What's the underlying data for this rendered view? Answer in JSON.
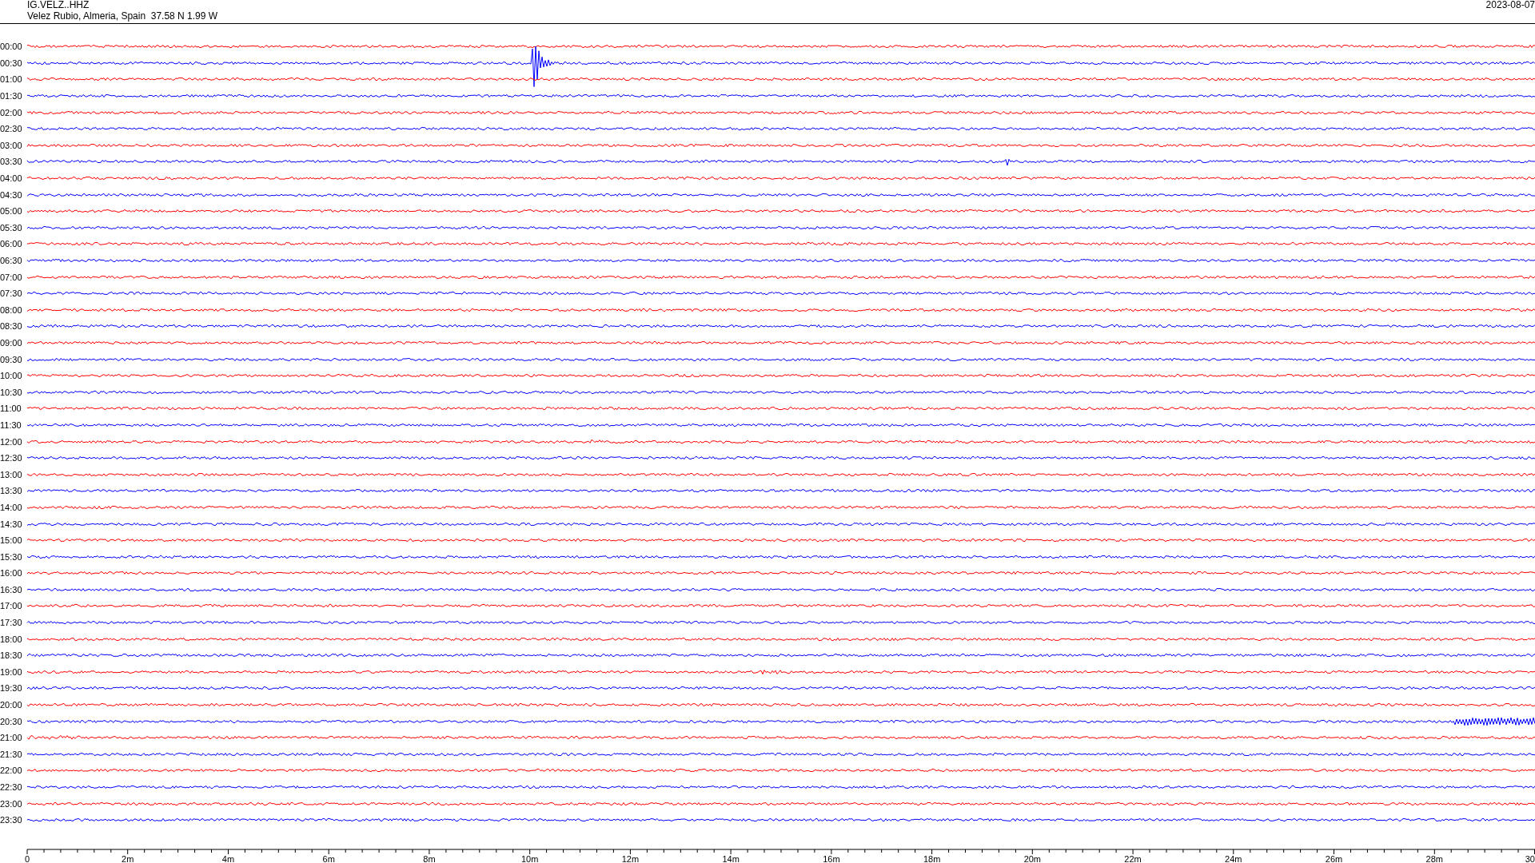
{
  "header": {
    "station": "IG.VELZ..HHZ",
    "location": "Velez Rubio, Almeria, Spain  37.58 N 1.99 W",
    "date": "2023-08-07"
  },
  "rows": [
    {
      "label": "00:00",
      "color": "#ff0000"
    },
    {
      "label": "00:30",
      "color": "#0000ff"
    },
    {
      "label": "01:00",
      "color": "#ff0000"
    },
    {
      "label": "01:30",
      "color": "#0000ff"
    },
    {
      "label": "02:00",
      "color": "#ff0000"
    },
    {
      "label": "02:30",
      "color": "#0000ff"
    },
    {
      "label": "03:00",
      "color": "#ff0000"
    },
    {
      "label": "03:30",
      "color": "#0000ff"
    },
    {
      "label": "04:00",
      "color": "#ff0000"
    },
    {
      "label": "04:30",
      "color": "#0000ff"
    },
    {
      "label": "05:00",
      "color": "#ff0000"
    },
    {
      "label": "05:30",
      "color": "#0000ff"
    },
    {
      "label": "06:00",
      "color": "#ff0000"
    },
    {
      "label": "06:30",
      "color": "#0000ff"
    },
    {
      "label": "07:00",
      "color": "#ff0000"
    },
    {
      "label": "07:30",
      "color": "#0000ff"
    },
    {
      "label": "08:00",
      "color": "#ff0000"
    },
    {
      "label": "08:30",
      "color": "#0000ff"
    },
    {
      "label": "09:00",
      "color": "#ff0000"
    },
    {
      "label": "09:30",
      "color": "#0000ff"
    },
    {
      "label": "10:00",
      "color": "#ff0000"
    },
    {
      "label": "10:30",
      "color": "#0000ff"
    },
    {
      "label": "11:00",
      "color": "#ff0000"
    },
    {
      "label": "11:30",
      "color": "#0000ff"
    },
    {
      "label": "12:00",
      "color": "#ff0000"
    },
    {
      "label": "12:30",
      "color": "#0000ff"
    },
    {
      "label": "13:00",
      "color": "#ff0000"
    },
    {
      "label": "13:30",
      "color": "#0000ff"
    },
    {
      "label": "14:00",
      "color": "#ff0000"
    },
    {
      "label": "14:30",
      "color": "#0000ff"
    },
    {
      "label": "15:00",
      "color": "#ff0000"
    },
    {
      "label": "15:30",
      "color": "#0000ff"
    },
    {
      "label": "16:00",
      "color": "#ff0000"
    },
    {
      "label": "16:30",
      "color": "#0000ff"
    },
    {
      "label": "17:00",
      "color": "#ff0000"
    },
    {
      "label": "17:30",
      "color": "#0000ff"
    },
    {
      "label": "18:00",
      "color": "#ff0000"
    },
    {
      "label": "18:30",
      "color": "#0000ff"
    },
    {
      "label": "19:00",
      "color": "#ff0000"
    },
    {
      "label": "19:30",
      "color": "#0000ff"
    },
    {
      "label": "20:00",
      "color": "#ff0000"
    },
    {
      "label": "20:30",
      "color": "#0000ff"
    },
    {
      "label": "21:00",
      "color": "#ff0000"
    },
    {
      "label": "21:30",
      "color": "#0000ff"
    },
    {
      "label": "22:00",
      "color": "#ff0000"
    },
    {
      "label": "22:30",
      "color": "#0000ff"
    },
    {
      "label": "23:00",
      "color": "#ff0000"
    },
    {
      "label": "23:30",
      "color": "#0000ff"
    }
  ],
  "axis": {
    "ticks": [
      "0",
      "2m",
      "4m",
      "6m",
      "8m",
      "10m",
      "12m",
      "14m",
      "16m",
      "18m",
      "20m",
      "22m",
      "24m",
      "26m",
      "28m",
      "30"
    ]
  }
}
